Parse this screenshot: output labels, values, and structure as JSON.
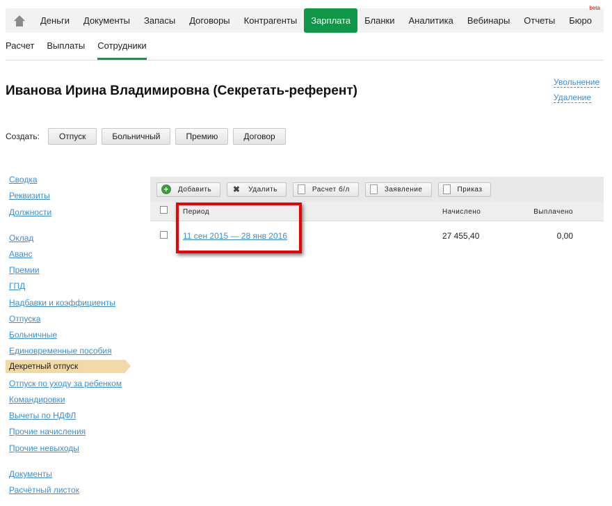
{
  "nav": {
    "home_icon": "home-icon",
    "items": [
      {
        "label": "Деньги"
      },
      {
        "label": "Документы"
      },
      {
        "label": "Запасы"
      },
      {
        "label": "Договоры"
      },
      {
        "label": "Контрагенты"
      },
      {
        "label": "Зарплата",
        "active": true
      },
      {
        "label": "Бланки"
      },
      {
        "label": "Аналитика"
      },
      {
        "label": "Вебинары"
      },
      {
        "label": "Отчеты"
      },
      {
        "label": "Бюро",
        "badge": "beta"
      }
    ]
  },
  "subnav": [
    {
      "label": "Расчет"
    },
    {
      "label": "Выплаты"
    },
    {
      "label": "Сотрудники",
      "active": true
    }
  ],
  "title": "Иванова Ирина Владимировна (Секретать-референт)",
  "actions": {
    "dismiss": "Увольнение",
    "delete": "Удаление"
  },
  "create": {
    "label": "Создать:",
    "buttons": [
      "Отпуск",
      "Больничный",
      "Премию",
      "Договор"
    ]
  },
  "sidebar": [
    "Сводка",
    "Реквизиты",
    "Должности",
    "Оклад",
    "Аванс",
    "Премии",
    "ГПД",
    "Надбавки и коэффициенты",
    "Отпуска",
    "Больничные",
    "Единовременные пособия",
    "Декретный отпуск",
    "Отпуск по уходу за ребенком",
    "Командировки",
    "Вычеты по НДФЛ",
    "Прочие начисления",
    "Прочие невыходы",
    "Документы",
    "Расчётный листок"
  ],
  "sidebar_active": "Декретный отпуск",
  "toolbar": [
    "Добавить",
    "Удалить",
    "Расчет б/л",
    "Заявление",
    "Приказ"
  ],
  "table": {
    "columns": [
      "Период",
      "Начислено",
      "Выплачено"
    ],
    "rows": [
      {
        "period": "11 сен 2015 — 28 янв 2016",
        "accrued": "27 455,40",
        "paid": "0,00"
      }
    ]
  },
  "colors": {
    "accent": "#0f9647",
    "link": "#3b8ed4",
    "highlight": "#e00000"
  }
}
